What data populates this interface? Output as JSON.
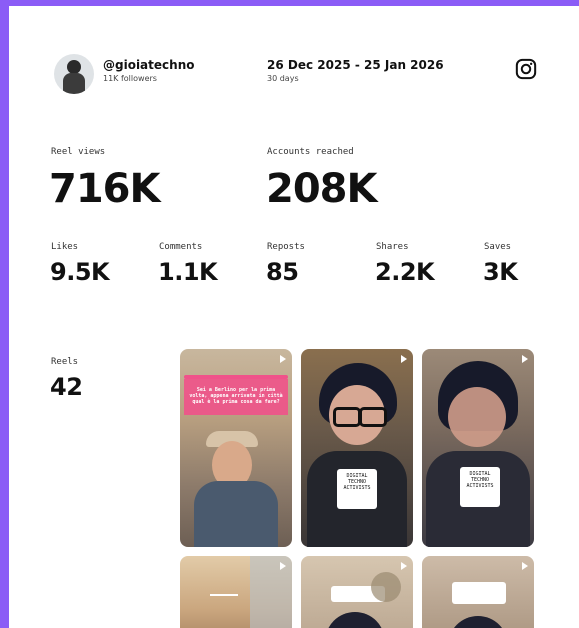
{
  "profile": {
    "username": "@gioiatechno",
    "followers": "11K followers",
    "avatar_icon": "profile-photo"
  },
  "period": {
    "range": "26 Dec 2025 - 25 Jan 2026",
    "days": "30 days"
  },
  "platform_icon": "instagram-icon",
  "metrics": {
    "reel_views": {
      "label": "Reel views",
      "value": "716K"
    },
    "accounts_reached": {
      "label": "Accounts reached",
      "value": "208K"
    },
    "likes": {
      "label": "Likes",
      "value": "9.5K"
    },
    "comments": {
      "label": "Comments",
      "value": "1.1K"
    },
    "reposts": {
      "label": "Reposts",
      "value": "85"
    },
    "shares": {
      "label": "Shares",
      "value": "2.2K"
    },
    "saves": {
      "label": "Saves",
      "value": "3K"
    },
    "reels": {
      "label": "Reels",
      "value": "42"
    }
  },
  "reel_thumbnails": [
    {
      "sticker_text": "Sei a Berlino per la prima volta, appena arrivata in città qual è la prima cosa da fare?"
    },
    {
      "sticker_text": "DIGITAL TECHNO ACTIVISTS"
    },
    {
      "sticker_text": "DIGITAL TECHNO ACTIVISTS"
    },
    {
      "sticker_text": ""
    },
    {
      "sticker_text": ""
    },
    {
      "sticker_text": ""
    }
  ],
  "colors": {
    "frame": "#8b5cf6",
    "card": "#ffffff",
    "text": "#111111",
    "sticker_pink": "#f0528a"
  }
}
